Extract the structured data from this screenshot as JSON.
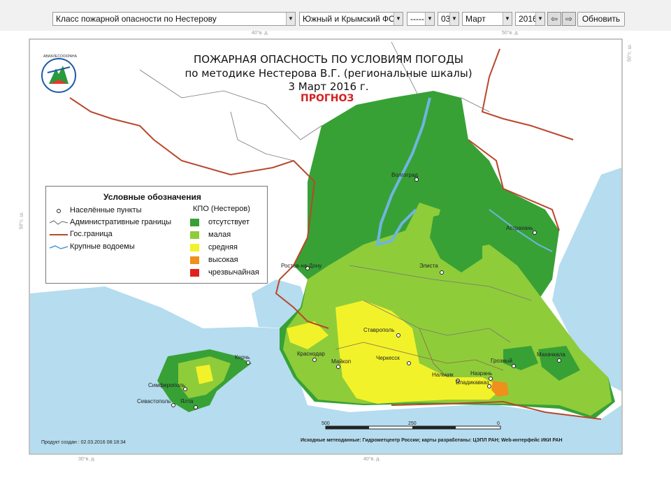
{
  "toolbar": {
    "product_select": "Класс пожарной опасности по Нестерову",
    "region_select": "Южный и Крымский ФО",
    "blank_select": "-----",
    "day_select": "03",
    "month_select": "Март",
    "year_select": "2016",
    "prev_icon": "arrow-left-icon",
    "next_icon": "arrow-right-icon",
    "refresh_label": "Обновить"
  },
  "map": {
    "title_line1": "ПОЖАРНАЯ ОПАСНОСТЬ ПО УСЛОВИЯМ ПОГОДЫ",
    "title_line2": "по методике Нестерова В.Г. (региональные шкалы)",
    "title_line3": "3 Март 2016 г.",
    "forecast_label": "ПРОГНОЗ",
    "logo_caption": "АВИАЛЕСООХРАНА",
    "coords": {
      "top_40": "40°в. д.",
      "top_50": "50°в. д.",
      "bottom_30": "30°в. д.",
      "bottom_40": "40°в. д.",
      "left_50": "50°с. ш.",
      "right_50": "50°с. ш."
    },
    "cities": {
      "volgograd": "Волгоград",
      "astrakhan": "Астрахань",
      "rostov": "Ростов-на-Дону",
      "elista": "Элиста",
      "stavropol": "Ставрополь",
      "krasnodar": "Краснодар",
      "maykop": "Майкоп",
      "cherkessk": "Черкесск",
      "nalchik": "Нальчик",
      "groznyy": "Грозный",
      "makhachkala": "Махачкала",
      "nazran": "Назрань",
      "vladikavkaz": "Владикавказ",
      "kerch": "Керчь",
      "simferopol": "Симферополь",
      "sevastopol": "Севастополь",
      "yalta": "Ялта"
    },
    "scale": {
      "left": "500",
      "mid": "250",
      "right": "0"
    },
    "footer_created": "Продукт создан : 02.03.2016 08:18:34",
    "footer_sources": "Исходные метеоданные: Гидрометцентр России; карты разработаны: ЦЭПЛ РАН; Web-интерфейс ИКИ РАН"
  },
  "legend": {
    "title": "Условные обозначения",
    "settlements": "Населённые пункты",
    "admin_borders": "Административные границы",
    "state_border": "Гос.граница",
    "water_bodies": "Крупные водоемы",
    "class_header": "КПО (Нестеров)",
    "classes": [
      {
        "label": "отсутствует",
        "color": "#37a136"
      },
      {
        "label": "малая",
        "color": "#8fcc3a"
      },
      {
        "label": "средняя",
        "color": "#f2f22a"
      },
      {
        "label": "высокая",
        "color": "#ef8f1c"
      },
      {
        "label": "чрезвычайная",
        "color": "#e0221e"
      }
    ]
  }
}
